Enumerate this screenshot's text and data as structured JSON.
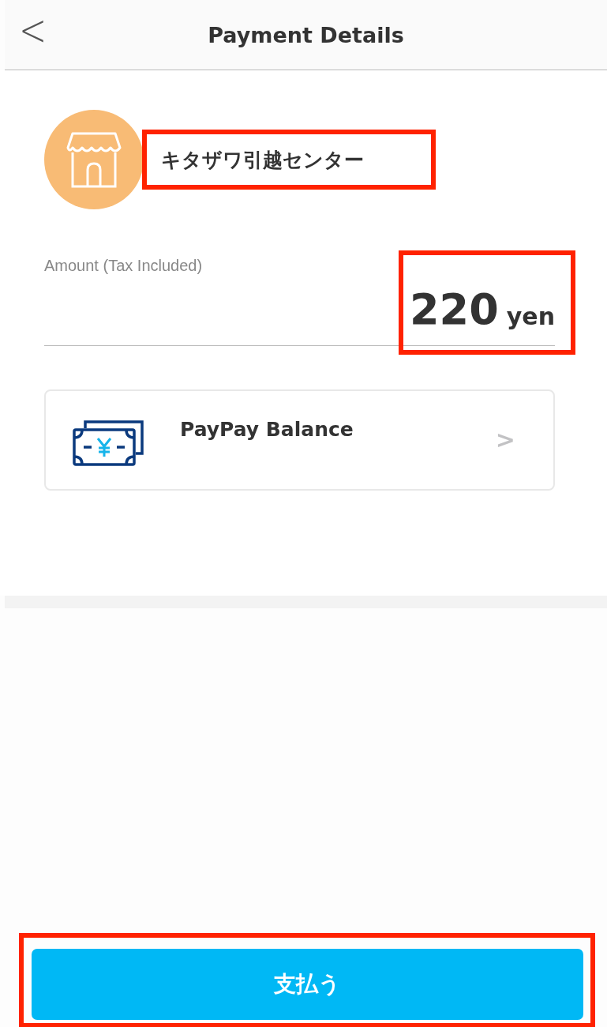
{
  "header": {
    "back": "<",
    "title": "Payment Details"
  },
  "merchant": {
    "name": "キタザワ引越センター",
    "highlighted": true
  },
  "amount": {
    "label": "Amount (Tax Included)",
    "value": "220",
    "unit": "yen",
    "highlighted": true
  },
  "payment_method": {
    "label": "PayPay Balance",
    "chevron": ">"
  },
  "pay_button": {
    "label": "支払う",
    "highlighted": true
  }
}
